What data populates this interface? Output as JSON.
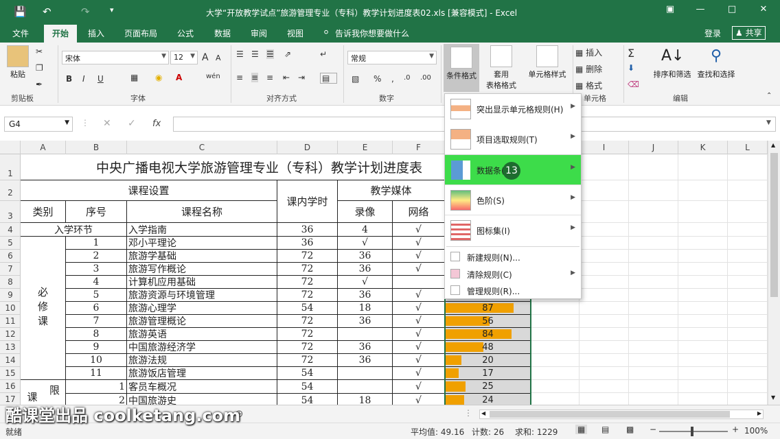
{
  "window": {
    "title": "大学“开放教学试点”旅游管理专业（专科）教学计划进度表02.xls  [兼容模式] - Excel"
  },
  "tabs": [
    "文件",
    "开始",
    "插入",
    "页面布局",
    "公式",
    "数据",
    "审阅",
    "视图"
  ],
  "tell_me": "告诉我你想要做什么",
  "account": {
    "login": "登录",
    "share": "共享"
  },
  "ribbon": {
    "paste": "粘贴",
    "clipboard": "剪贴板",
    "font_name": "宋体",
    "font_size": "12",
    "font_group": "字体",
    "align_group": "对齐方式",
    "number_format": "常规",
    "number_group": "数字",
    "cond_format": "条件格式",
    "table_format_1": "套用",
    "table_format_2": "表格格式",
    "cell_style": "单元格样式",
    "insert": "插入",
    "delete": "删除",
    "format": "格式",
    "cells_group": "单元格",
    "sort_filter": "排序和筛选",
    "find_select": "查找和选择",
    "edit_group": "编辑",
    "bold": "B",
    "italic": "I",
    "underline": "U",
    "percent": "%"
  },
  "formula_bar": {
    "name_box": "G4",
    "fx": "fx",
    "content": ""
  },
  "columns": [
    "A",
    "B",
    "C",
    "D",
    "E",
    "F",
    "G",
    "H",
    "I",
    "J",
    "K",
    "L"
  ],
  "rows": [
    "1",
    "2",
    "3",
    "4",
    "5",
    "6",
    "7",
    "8",
    "9",
    "10",
    "11",
    "12",
    "13",
    "14",
    "15",
    "16",
    "17"
  ],
  "sheet": {
    "title": "中央广播电视大学旅游管理专业（专科）教学计划进度表",
    "h_course": "课程设置",
    "h_hours": "课内学时",
    "h_media": "教学媒体",
    "h_cat": "类别",
    "h_no": "序号",
    "h_name": "课程名称",
    "h_video": "录像",
    "h_net": "网络",
    "r4_label": "入学环节",
    "r4_name": "入学指南",
    "r4_hours": "36",
    "r4_video": "4",
    "r4_net": "√",
    "req_label": "必修课",
    "req_rows": [
      {
        "no": "1",
        "name": "邓小平理论",
        "hours": "36",
        "video": "√",
        "net": "√",
        "g": ""
      },
      {
        "no": "2",
        "name": "旅游学基础",
        "hours": "72",
        "video": "36",
        "net": "√",
        "g": ""
      },
      {
        "no": "3",
        "name": "旅游写作概论",
        "hours": "72",
        "video": "36",
        "net": "√",
        "g": ""
      },
      {
        "no": "4",
        "name": "计算机应用基础",
        "hours": "72",
        "video": "√",
        "net": "",
        "g": ""
      },
      {
        "no": "5",
        "name": "旅游资源与环境管理",
        "hours": "72",
        "video": "36",
        "net": "√",
        "g": ""
      },
      {
        "no": "6",
        "name": "旅游心理学",
        "hours": "54",
        "video": "18",
        "net": "√",
        "g": "87"
      },
      {
        "no": "7",
        "name": "旅游管理概论",
        "hours": "72",
        "video": "36",
        "net": "√",
        "g": "56"
      },
      {
        "no": "8",
        "name": "旅游英语",
        "hours": "72",
        "video": "",
        "net": "√",
        "g": "84"
      },
      {
        "no": "9",
        "name": "中国旅游经济学",
        "hours": "72",
        "video": "36",
        "net": "√",
        "g": "48"
      },
      {
        "no": "10",
        "name": "旅游法规",
        "hours": "72",
        "video": "36",
        "net": "√",
        "g": "20"
      },
      {
        "no": "11",
        "name": "旅游饭店管理",
        "hours": "54",
        "video": "",
        "net": "√",
        "g": "17"
      }
    ],
    "lim_label_a": "课",
    "lim_label_b": "限",
    "lim_rows": [
      {
        "no": "1",
        "name": "客员车概况",
        "hours": "54",
        "video": "",
        "net": "√",
        "g": "25"
      },
      {
        "no": "2",
        "name": "中国旅游史",
        "hours": "54",
        "video": "18",
        "net": "√",
        "g": "24"
      }
    ]
  },
  "dropdown": {
    "items": [
      {
        "label": "突出显示单元格规则(H)"
      },
      {
        "label": "项目选取规则(T)"
      },
      {
        "label": "数据条(D)"
      },
      {
        "label": "色阶(S)"
      },
      {
        "label": "图标集(I)"
      }
    ],
    "small_items": [
      "新建规则(N)...",
      "清除规则(C)",
      "管理规则(R)..."
    ],
    "step_badge": "13"
  },
  "statusbar": {
    "ready": "就绪",
    "average": "平均值: 49.16",
    "count": "计数: 26",
    "sum": "求和: 1229",
    "zoom": "100%"
  },
  "watermark": "酷课堂出品 coolketang.com",
  "colors": {
    "excel_green": "#217346",
    "menu_highlight": "#3ddc4a",
    "databar": "#f0a000",
    "badge": "#1e6b2f"
  }
}
